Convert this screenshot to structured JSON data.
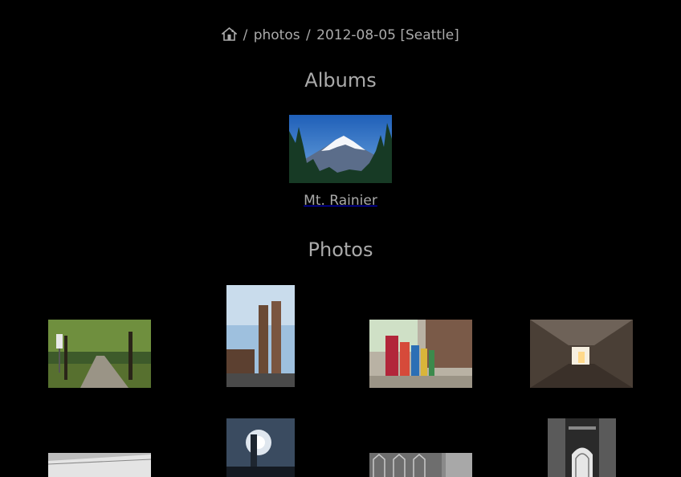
{
  "breadcrumb": {
    "home_icon": "home-icon",
    "separator": "/",
    "items": [
      "photos",
      "2012-08-05 [Seattle]"
    ]
  },
  "albums_section": {
    "heading": "Albums",
    "albums": [
      {
        "caption": "Mt. Rainier"
      }
    ]
  },
  "photos_section": {
    "heading": "Photos"
  },
  "colors": {
    "background": "#000000",
    "text": "#aaaaaa"
  }
}
